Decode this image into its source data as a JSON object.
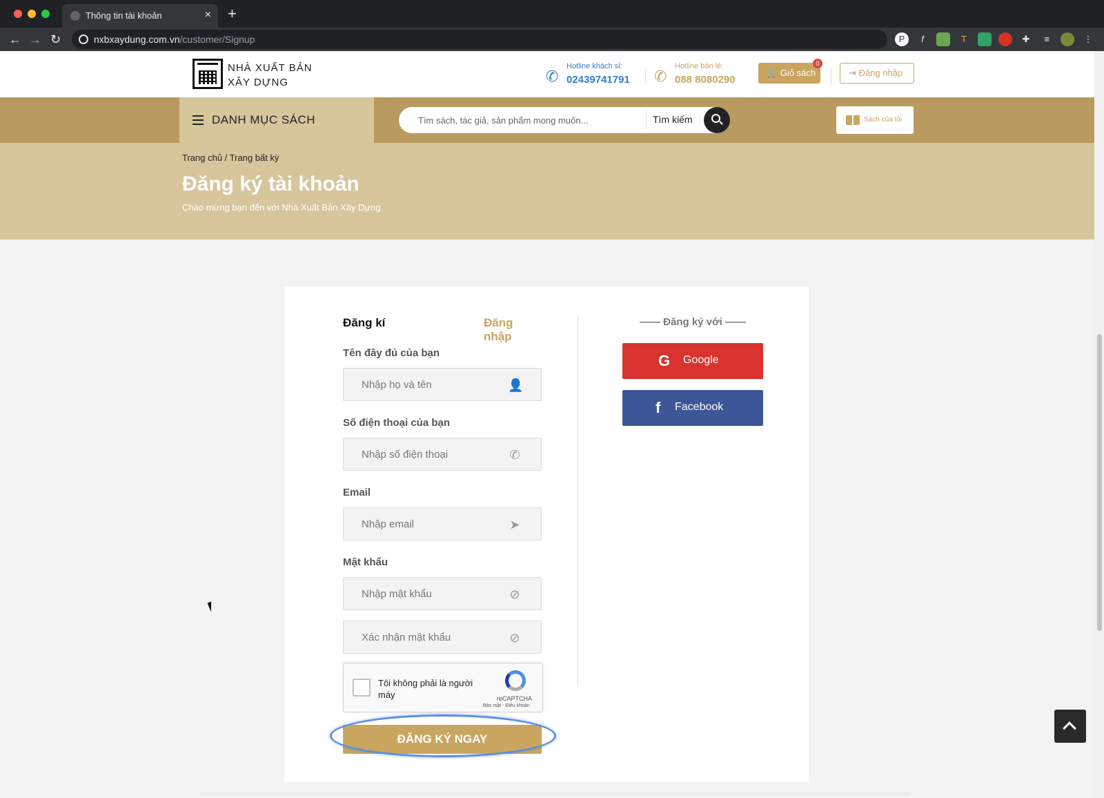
{
  "browser": {
    "tab_title": "Thông tin tài khoản",
    "tab_close": "×",
    "new_tab": "+",
    "url_host": "nxbxaydung.com.vn",
    "url_path": "/customer/Signup",
    "nav_back": "←",
    "nav_forward": "→",
    "nav_reload": "↻"
  },
  "header": {
    "logo_line1": "NHÀ XUẤT BẢN",
    "logo_line2": "XÂY DỰNG",
    "hotline_wholesale_label": "Hotline khách sỉ:",
    "hotline_wholesale_number": "02439741791",
    "hotline_retail_label": "Hotline bán lẻ:",
    "hotline_retail_number": "088 8080290",
    "cart_label": "Giỏ sách",
    "cart_count": "0",
    "login_label": "Đăng nhập"
  },
  "menubar": {
    "category_title": "DANH MỤC SÁCH",
    "search_placeholder": "Tìm sách, tác giả, sản phẩm mong muốn...",
    "search_label": "Tìm kiếm",
    "my_books_label": "Sách của tôi"
  },
  "hero": {
    "breadcrumb": "Trang chủ / Trang bất kỳ",
    "title": "Đăng ký tài khoản",
    "subtitle": "Chào mừng bạn đến với Nhà Xuất Bản Xây Dựng"
  },
  "form": {
    "tab_register": "Đăng kí",
    "tab_login": "Đăng nhập",
    "name_label": "Tên đầy đủ của bạn",
    "name_placeholder": "Nhập họ và tên",
    "phone_label": "Số điện thoại của bạn",
    "phone_placeholder": "Nhập số điện thoại",
    "email_label": "Email",
    "email_placeholder": "Nhập email",
    "password_label": "Mật khẩu",
    "password_placeholder": "Nhập mật khẩu",
    "confirm_placeholder": "Xác nhận mật khẩu",
    "captcha_text": "Tôi không phải là người máy",
    "captcha_brand": "reCAPTCHA",
    "captcha_links": "Bảo mật - Điều khoản",
    "submit_label": "ĐĂNG KÝ NGAY"
  },
  "social": {
    "title": "—— Đăng ký với ——",
    "google_label": "Google",
    "facebook_label": "Facebook"
  },
  "colors": {
    "gold": "#c9a55f",
    "menubar": "#b99a5f",
    "hero": "#d7c59c",
    "google": "#d8332e",
    "facebook": "#3c5698",
    "hotline_blue": "#2f7fd1"
  }
}
